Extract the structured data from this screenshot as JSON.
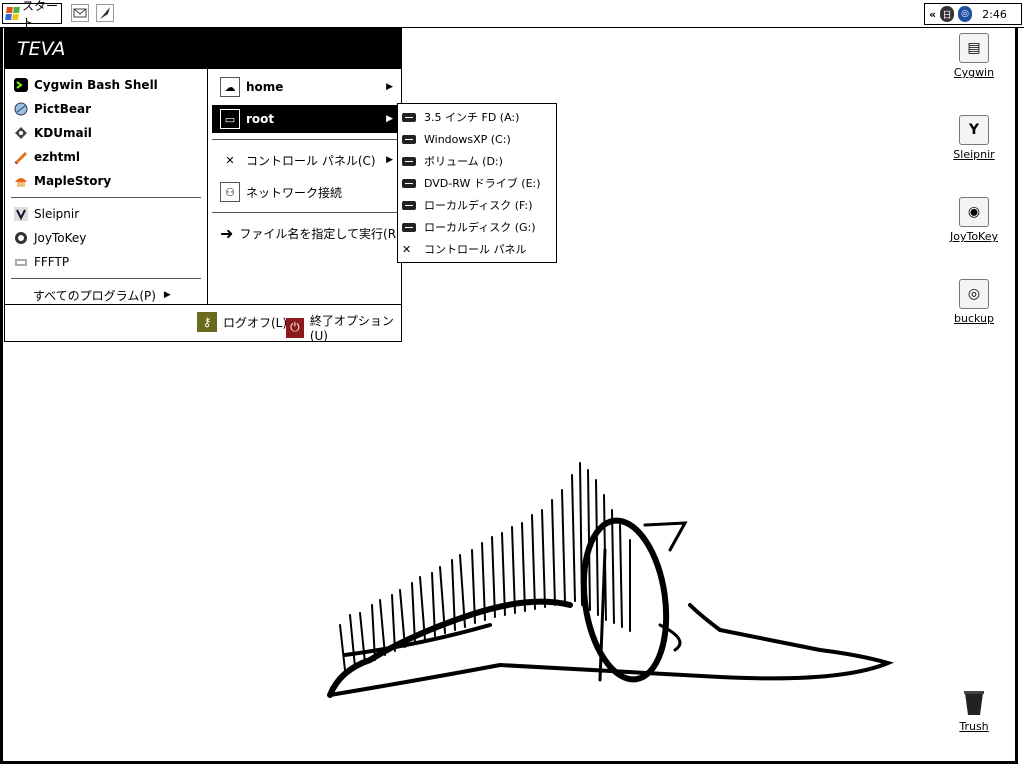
{
  "taskbar": {
    "start_label": "スタート",
    "clock": "2:46",
    "tray_collapse": "«"
  },
  "start_menu": {
    "user": "TEVA",
    "pinned": [
      {
        "label": "Cygwin Bash Shell",
        "icon": "cygwin-icon"
      },
      {
        "label": "PictBear",
        "icon": "pictbear-icon"
      },
      {
        "label": "KDUmail",
        "icon": "kdumail-icon"
      },
      {
        "label": "ezhtml",
        "icon": "ezhtml-icon"
      },
      {
        "label": "MapleStory",
        "icon": "maplestory-icon"
      }
    ],
    "recent": [
      {
        "label": "Sleipnir",
        "icon": "sleipnir-icon"
      },
      {
        "label": "JoyToKey",
        "icon": "joytokey-icon"
      },
      {
        "label": "FFFTP",
        "icon": "ffftp-icon"
      }
    ],
    "all_programs": "すべてのプログラム(P)",
    "places": {
      "home": "home",
      "root": "root",
      "control_panel": "コントロール パネル(C)",
      "network": "ネットワーク接続",
      "run": "ファイル名を指定して実行(R)..."
    },
    "logoff": "ログオフ(L)",
    "shutdown": "終了オプション(U)"
  },
  "root_submenu": [
    {
      "label": "3.5 インチ FD (A:)"
    },
    {
      "label": "WindowsXP (C:)"
    },
    {
      "label": "ボリューム (D:)"
    },
    {
      "label": "DVD-RW ドライブ (E:)"
    },
    {
      "label": "ローカルディスク (F:)"
    },
    {
      "label": "ローカルディスク (G:)"
    },
    {
      "label": "コントロール パネル"
    }
  ],
  "desktop_icons": [
    {
      "label": "Cygwin",
      "icon": "cygwin-shortcut-icon"
    },
    {
      "label": "Sleipnir",
      "icon": "sleipnir-shortcut-icon"
    },
    {
      "label": "JoyToKey",
      "icon": "joytokey-shortcut-icon"
    },
    {
      "label": "buckup",
      "icon": "backup-shortcut-icon"
    },
    {
      "label": "Trush",
      "icon": "trash-icon"
    }
  ],
  "colors": {
    "menu_header_bg": "#000000",
    "selected_bg": "#000000",
    "logoff_icon": "#6b6b1e",
    "shutdown_icon": "#8b1a1a"
  }
}
